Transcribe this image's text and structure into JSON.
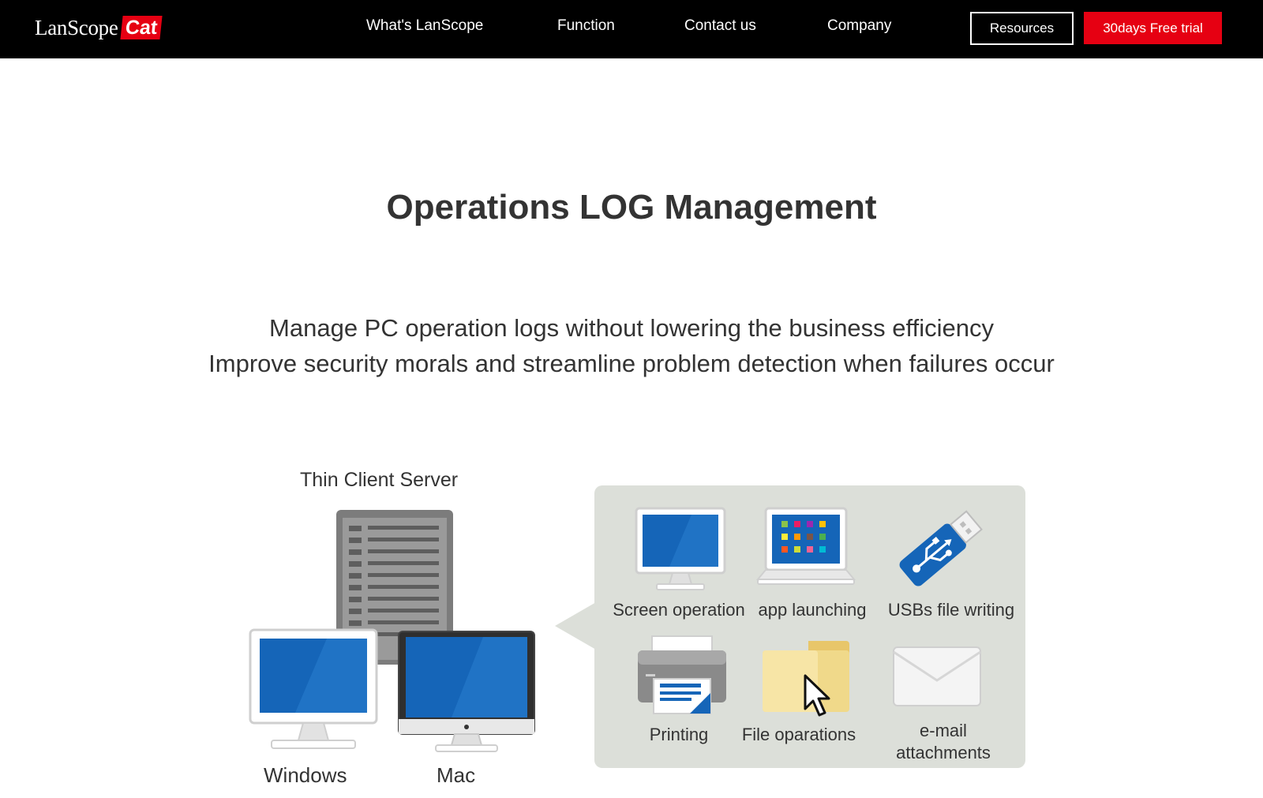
{
  "header": {
    "logo_text": "LanScope",
    "logo_badge": "Cat",
    "nav": [
      "What's LanScope",
      "Function",
      "Contact us",
      "Company"
    ],
    "resources_label": "Resources",
    "trial_label": "30days Free trial",
    "trial_color": "#e60012"
  },
  "main": {
    "title": "Operations LOG Management",
    "subtitle_line1": "Manage PC operation logs without lowering the business efficiency",
    "subtitle_line2": "Improve security morals and streamline problem detection when failures occur"
  },
  "diagram": {
    "server_label": "Thin Client Server",
    "windows_label": "Windows",
    "mac_label": "Mac",
    "operations": [
      {
        "label": "Screen operation",
        "icon": "monitor-icon"
      },
      {
        "label": "app launching",
        "icon": "laptop-icon"
      },
      {
        "label": "USBs file writing",
        "icon": "usb-icon"
      },
      {
        "label": "Printing",
        "icon": "printer-icon"
      },
      {
        "label": "File oparations",
        "icon": "folder-icon"
      },
      {
        "label_line1": "e-mail",
        "label_line2": "attachments",
        "icon": "envelope-icon"
      }
    ],
    "colors": {
      "screen_blue": "#1565b8",
      "panel_bg": "#dcdfd9"
    }
  }
}
